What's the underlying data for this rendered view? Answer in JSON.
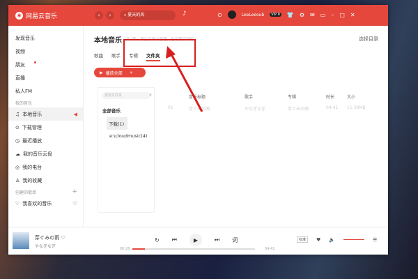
{
  "app": {
    "name": "网易云音乐",
    "search_placeholder": "夏天的风",
    "user": "LeeLeeoub",
    "vip": "VIP 8"
  },
  "sidebar": {
    "items": [
      {
        "label": "发现音乐"
      },
      {
        "label": "视频"
      },
      {
        "label": "朋友"
      },
      {
        "label": "直播"
      },
      {
        "label": "私人FM"
      }
    ],
    "my_music_title": "我的音乐",
    "my_music": [
      {
        "label": "本地音乐",
        "icon": "music-note-icon"
      },
      {
        "label": "下载管理",
        "icon": "download-icon"
      },
      {
        "label": "最近播放",
        "icon": "clock-icon"
      },
      {
        "label": "我的音乐云盘",
        "icon": "cloud-icon"
      },
      {
        "label": "我的电台",
        "icon": "radio-icon"
      },
      {
        "label": "我的收藏",
        "icon": "person-icon"
      }
    ],
    "created_title": "创建的歌单",
    "liked": "我喜欢的音乐"
  },
  "main": {
    "title": "本地音乐",
    "subtitle": "共1首，请在目录中管理，也可尊享特权",
    "select_dir": "选择目录",
    "tabs": [
      "歌曲",
      "歌手",
      "专辑",
      "文件夹"
    ],
    "active_tab": 3,
    "play_all": "播放全部",
    "folder_search_placeholder": "搜找文件夹",
    "tree": {
      "root": "全部音乐",
      "items": [
        "下载(1)",
        "e:\\cloudmusic(4)"
      ]
    },
    "columns": [
      "",
      "音乐标题",
      "歌手",
      "专辑",
      "时长",
      "大小"
    ],
    "rows": [
      [
        "01",
        "芽ぐみの雨",
        "やなぎなぎ",
        "芽ぐみの雨",
        "04:41",
        "11.36MB"
      ]
    ]
  },
  "player": {
    "song": "芽ぐみの雨",
    "artist": "やなぎなぎ",
    "elapsed": "00:28",
    "duration": "04:41",
    "progress": 0.1,
    "lyric": "词",
    "quality": "标准",
    "volume": 1.0
  },
  "colors": {
    "accent": "#e5473c",
    "annotation": "#d62020"
  }
}
